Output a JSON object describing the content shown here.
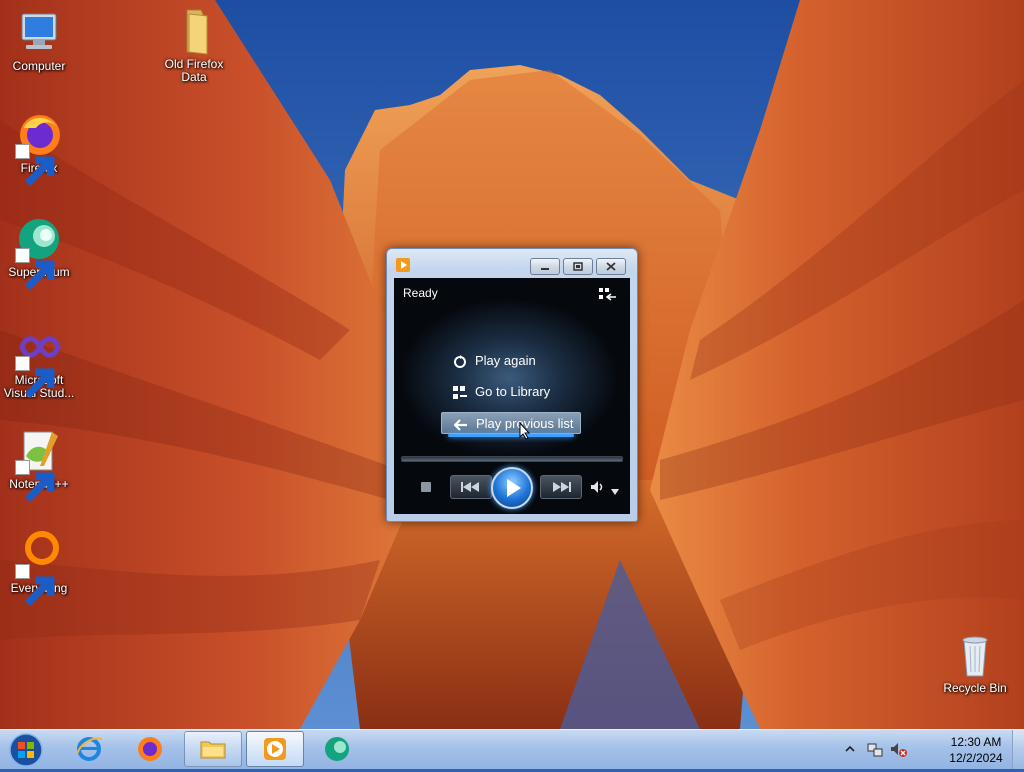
{
  "desktop": {
    "icons": [
      {
        "label": "Computer",
        "icon": "computer-icon"
      },
      {
        "label": "Old Firefox Data",
        "icon": "folder-icon"
      },
      {
        "label": "Firefox",
        "icon": "firefox-icon"
      },
      {
        "label": "Supermium",
        "icon": "supermium-icon"
      },
      {
        "label": "Microsoft Visual Stud...",
        "icon": "visual-studio-icon"
      },
      {
        "label": "Notepad++",
        "icon": "notepad-plus-plus-icon"
      },
      {
        "label": "Everything",
        "icon": "everything-icon"
      },
      {
        "label": "Recycle Bin",
        "icon": "recycle-bin-icon"
      }
    ]
  },
  "media_player": {
    "status": "Ready",
    "menu": [
      {
        "label": "Play again",
        "icon": "replay-icon"
      },
      {
        "label": "Go to Library",
        "icon": "library-icon"
      },
      {
        "label": "Play previous list",
        "icon": "back-arrow-icon",
        "hovered": true
      }
    ],
    "accent": "#1f73d8"
  },
  "taskbar": {
    "items": [
      "start-orb",
      "internet-explorer",
      "firefox",
      "file-explorer",
      "windows-media-player",
      "supermium"
    ],
    "active": "windows-media-player",
    "clock": {
      "time": "12:30 AM",
      "date": "12/2/2024"
    }
  }
}
